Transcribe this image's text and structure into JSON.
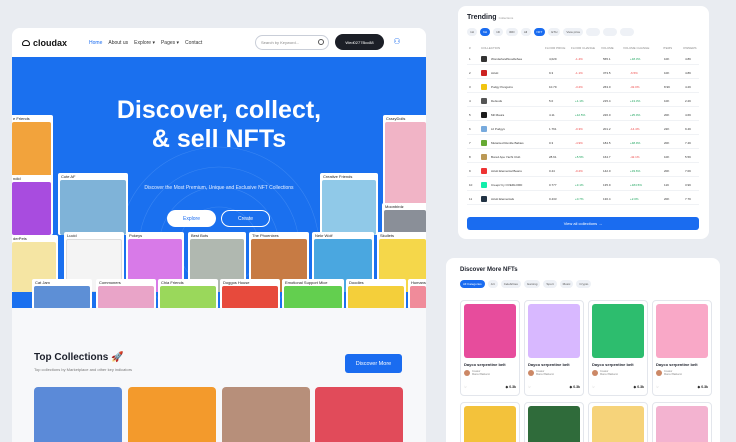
{
  "nav": {
    "brand": "cloudax",
    "menu": [
      {
        "label": "Home",
        "active": true
      },
      {
        "label": "About us"
      },
      {
        "label": "Explore ▾"
      },
      {
        "label": "Pages ▾"
      },
      {
        "label": "Contact"
      }
    ],
    "search_placeholder": "Search by Keyword...",
    "wallet": "Wed0277Bcc88"
  },
  "hero": {
    "title_line1": "Discover, collect,",
    "title_line2": "& sell NFTs",
    "subtitle": "Discover the Most Premium, Unique and Exclusive NFT Collections",
    "explore": "Explore",
    "create": "Create",
    "cards": [
      "e Friends",
      "CrazyDolls",
      "ndid",
      "Cute AF",
      "Creative Friends",
      "Moonbirdz",
      "Lucid",
      "Pokeys",
      "Best Bots",
      "The Phoenixes",
      "Nekr Wolf",
      "Skullets",
      "derPets",
      "Cat Jam",
      "Commoners",
      "Chia Friends",
      "Doggos House",
      "Emotional Support Mice",
      "Doodles",
      "Humans"
    ]
  },
  "top_collections": {
    "title": "Top Collections 🚀",
    "subtitle": "Top collections by Marketplace and other key indicators",
    "button": "Discover More"
  },
  "trending": {
    "title": "Trending",
    "title_small": "Collections",
    "filters": [
      "1H",
      "6H",
      "1D",
      "30D",
      "All",
      "NFT",
      "ETH",
      "View price",
      "",
      "",
      ""
    ],
    "columns": [
      "#",
      "COLLECTION",
      "FLOOR PRICE",
      "FLOOR CHANGE",
      "VOLUME",
      "VOLUME CHANGE",
      "ITEMS",
      "OWNERS"
    ],
    "rows": [
      {
        "n": "1",
        "name": "WonderlandNoodleSea",
        "floor": "4,029",
        "fchg": "-1.4%",
        "vol": "565.1",
        "vchg": "+18.3%",
        "items": "10K",
        "owners": "4.8K",
        "color": "#333"
      },
      {
        "n": "2",
        "name": "Azuki",
        "floor": "9.3",
        "fchg": "-1.1%",
        "vol": "373.5",
        "vchg": "-6.5%",
        "items": "10K",
        "owners": "4.8K",
        "color": "#c22"
      },
      {
        "n": "3",
        "name": "Pudgy Penguins",
        "floor": "10.79",
        "fchg": "-3.2%",
        "vol": "263.0",
        "vchg": "-32.0%",
        "items": "8.9K",
        "owners": "4.2K",
        "color": "#f1c40f"
      },
      {
        "n": "4",
        "name": "DeGods",
        "floor": "5.0",
        "fchg": "+1.1%",
        "vol": "215.4",
        "vchg": "+13.3%",
        "items": "10K",
        "owners": "2.2K",
        "color": "#555"
      },
      {
        "n": "5",
        "name": "Mil Maura",
        "floor": "4.11",
        "fchg": "+12.5%",
        "vol": "226.0",
        "vchg": "+25.0%",
        "items": "20K",
        "owners": "4.6K",
        "color": "#1c1c1c"
      },
      {
        "n": "6",
        "name": "Lil Pudgys",
        "floor": "1.761",
        "fchg": "-0.3%",
        "vol": "201.2",
        "vchg": "-14.4%",
        "items": "22K",
        "owners": "9.4K",
        "color": "#7ad"
      },
      {
        "n": "7",
        "name": "Mutanted Rentile Babies",
        "floor": "0.3",
        "fchg": "-4.9%",
        "vol": "184.5",
        "vchg": "+48.9%",
        "items": "20K",
        "owners": "7.4K",
        "color": "#6a3"
      },
      {
        "n": "8",
        "name": "Bored Ape Yacht Club",
        "floor": "28.61",
        "fchg": "+5.5%",
        "vol": "164.7",
        "vchg": "-42.1%",
        "items": "10K",
        "owners": "5.5K",
        "color": "#b95"
      },
      {
        "n": "9",
        "name": "Azuki Elemental Beans",
        "floor": "0.44",
        "fchg": "-0.2%",
        "vol": "142.0",
        "vchg": "+33.6%",
        "items": "20K",
        "owners": "7.0K",
        "color": "#e33"
      },
      {
        "n": "10",
        "name": "Creepz by OVERLORD",
        "floor": "0.777",
        "fchg": "+3.1%",
        "vol": "135.9",
        "vchg": "+184.5%",
        "items": "11K",
        "owners": "3.9K",
        "color": "#1ea"
      },
      {
        "n": "11",
        "name": "Azuki Elementals",
        "floor": "0.433",
        "fchg": "+0.7%",
        "vol": "130.4",
        "vchg": "+2.0%",
        "items": "20K",
        "owners": "7.7K",
        "color": "#234"
      }
    ],
    "view_all": "View all collections →"
  },
  "discover": {
    "title": "Discover More NFTs",
    "categories": [
      "All Categories",
      "Art",
      "Celebrities",
      "Gaming",
      "Sport",
      "Music",
      "Crypto"
    ],
    "items": [
      {
        "name": "Dayco serpentine belt",
        "creator_role": "Creator",
        "creator": "Marcel Bakkerst",
        "price": "0.3k",
        "bg": "#e74c9c"
      },
      {
        "name": "Dayco serpentine belt",
        "creator_role": "Creator",
        "creator": "Marcel Bakkerst",
        "price": "0.3k",
        "bg": "#d8b8ff"
      },
      {
        "name": "Dayco serpentine belt",
        "creator_role": "Creator",
        "creator": "Marcel Bakkerst",
        "price": "0.3k",
        "bg": "#2dbd6e"
      },
      {
        "name": "Dayco serpentine belt",
        "creator_role": "Creator",
        "creator": "Marcel Bakkerst",
        "price": "0.3k",
        "bg": "#f9a8c7"
      }
    ],
    "row2": [
      "#f3c23b",
      "#2f6b3a",
      "#f6d37a",
      "#f3b3d0"
    ]
  },
  "colors": {
    "accent": "#1a6cf0",
    "hero": "#1a70ef",
    "dark": "#1c1f27"
  }
}
